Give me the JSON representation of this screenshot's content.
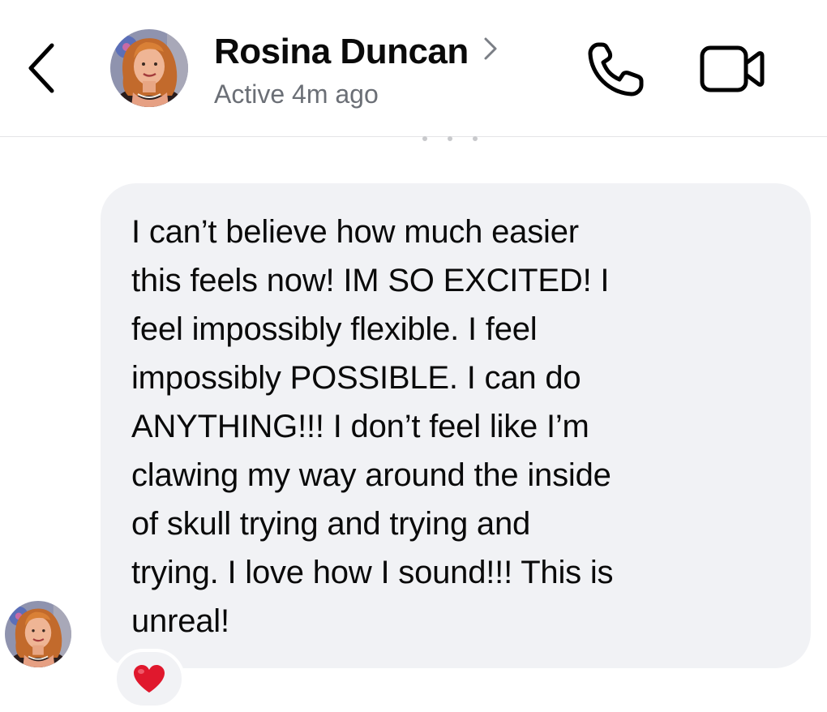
{
  "header": {
    "contact_name": "Rosina Duncan",
    "status": "Active 4m ago",
    "icons": {
      "back": "chevron-left-icon",
      "name_chevron": "chevron-right-icon",
      "call": "phone-icon",
      "video": "video-camera-icon"
    }
  },
  "conversation": {
    "messages": [
      {
        "text": "I can’t believe how much easier\nthis feels now!   IM SO EXCITED!   I\nfeel impossibly flexible.  I feel\nimpossibly POSSIBLE.  I can do\nANYTHING!!!  I don’t feel like I’m\nclawing my way around the inside\nof skull trying and trying and\ntrying.  I love how I sound!!!  This is\nunreal!",
        "reaction": "❤️",
        "reaction_icon": "red-heart-icon"
      }
    ]
  },
  "colors": {
    "bubble_background": "#f1f2f5",
    "secondary_text": "#6b6f76",
    "reaction_heart": "#e0182d"
  }
}
